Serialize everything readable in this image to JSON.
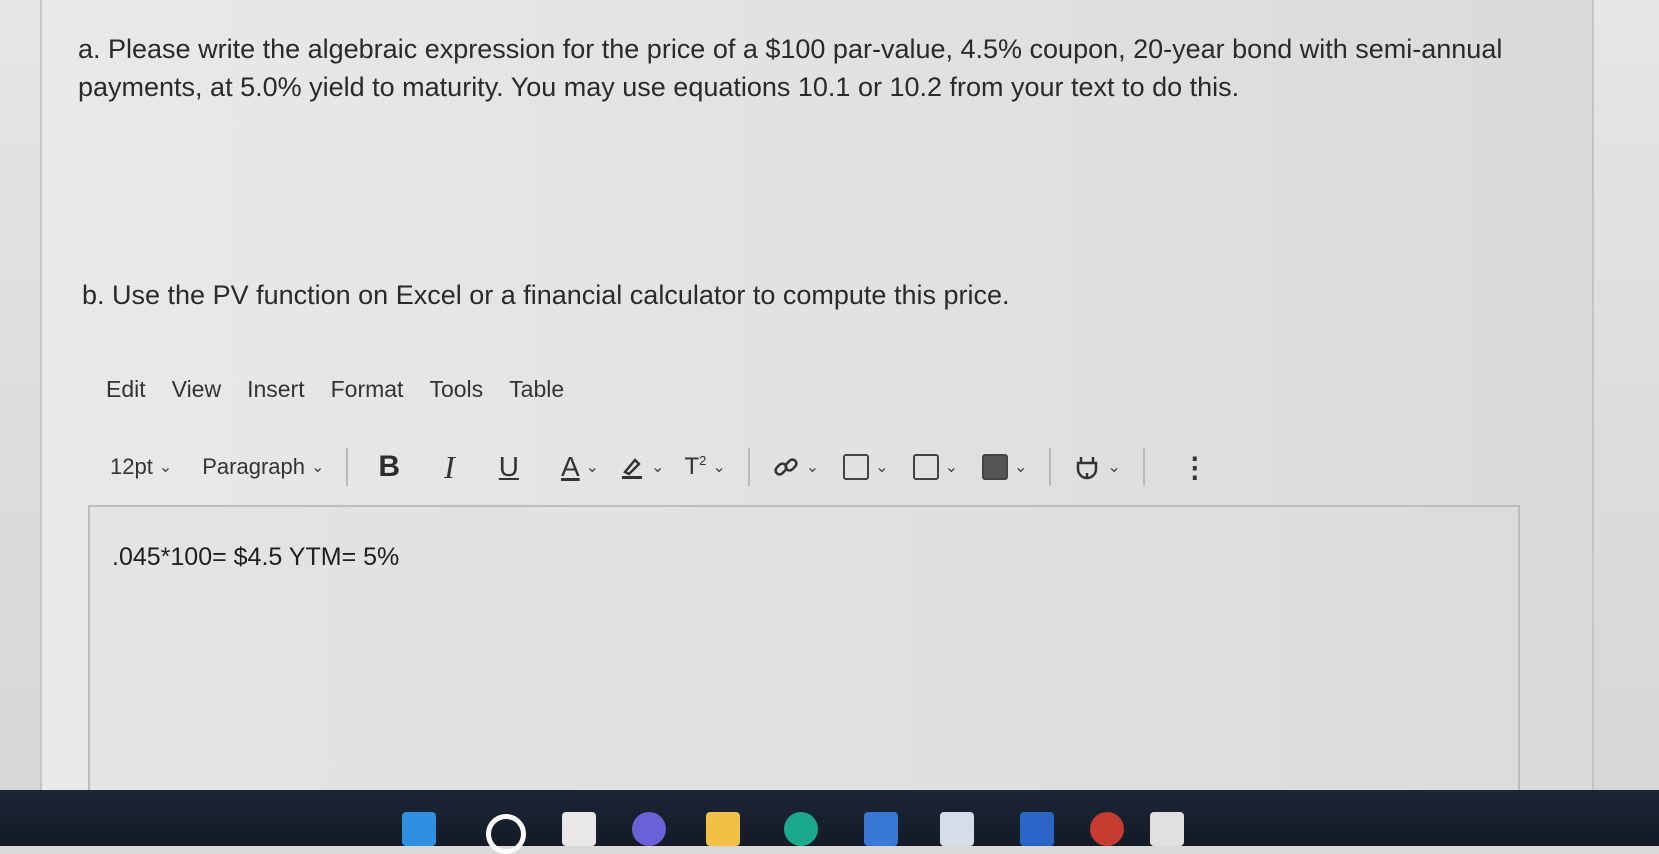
{
  "question_a": "a. Please write the algebraic expression for the price of a $100 par-value, 4.5% coupon, 20-year bond with semi-annual payments, at 5.0% yield to maturity. You may use equations 10.1 or 10.2 from your text to do this.",
  "question_b": "b. Use the PV function on Excel or a financial calculator to compute this price.",
  "menu": {
    "edit": "Edit",
    "view": "View",
    "insert": "Insert",
    "format": "Format",
    "tools": "Tools",
    "table": "Table"
  },
  "toolbar": {
    "font_size": "12pt",
    "block_format": "Paragraph",
    "bold": "B",
    "italic": "I",
    "underline": "U",
    "text_color": "A",
    "superscript": "T",
    "superscript_mark": "2",
    "more": "⋮",
    "icons": [
      "bold-icon",
      "italic-icon",
      "underline-icon",
      "text-color-icon",
      "highlight-icon",
      "superscript-icon",
      "link-icon",
      "image-icon",
      "media-icon",
      "document-icon",
      "plugin-icon",
      "more-options-icon"
    ]
  },
  "editor": {
    "content": ".045*100= $4.5 YTM= 5%"
  },
  "colors": {
    "background": "#dedede",
    "taskbar": "#1a2331",
    "text": "#2a2a2a"
  }
}
